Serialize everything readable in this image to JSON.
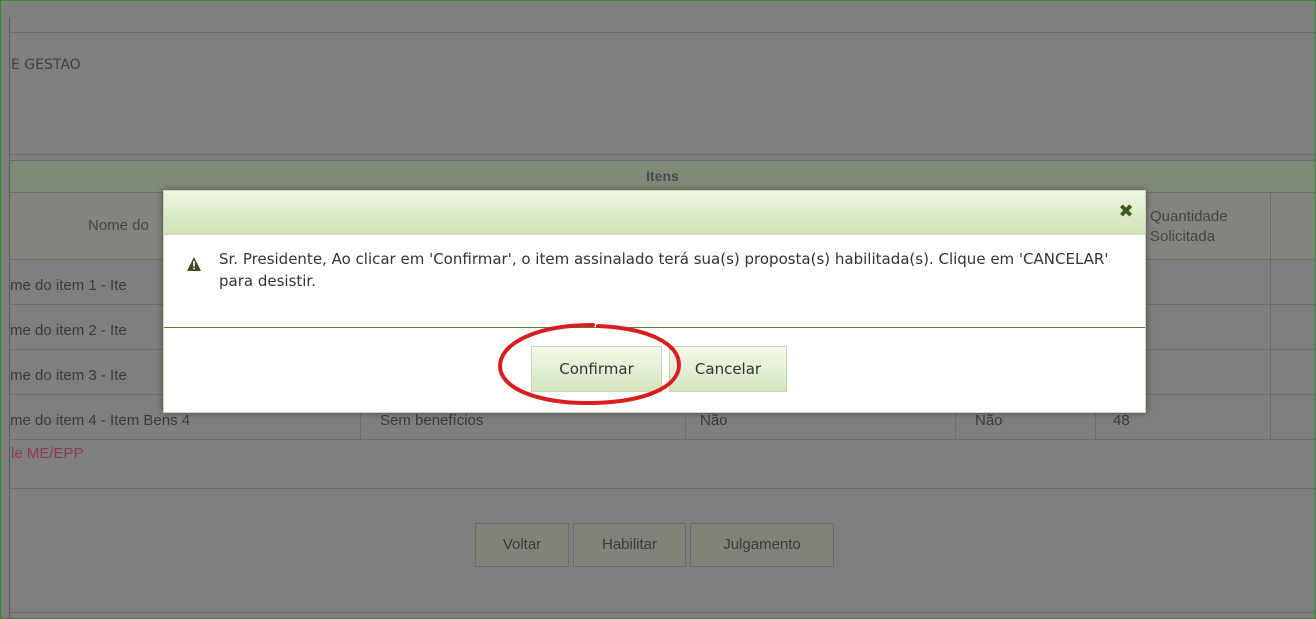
{
  "background": {
    "header_text": "E GESTAO",
    "section_title": "Itens",
    "columns": {
      "nome": "Nome do",
      "quantidade_line1": "Quantidade",
      "quantidade_line2": "Solicitada"
    },
    "rows": [
      {
        "name": "me do item 1 - Ite"
      },
      {
        "name": "me do item 2 - Ite"
      },
      {
        "name": "me do item 3 - Ite"
      },
      {
        "name": "me do item 4 - Item Bens 4",
        "beneficio": "Sem benefícios",
        "col3": "Não",
        "col4": "Não",
        "quantidade": "48"
      }
    ],
    "me_epp_label": "le ME/EPP",
    "buttons": {
      "voltar": "Voltar",
      "habilitar": "Habilitar",
      "julgamento": "Julgamento"
    }
  },
  "modal": {
    "close_icon": "✖",
    "warning_icon": "warning-triangle",
    "message": "Sr. Presidente, Ao clicar em 'Confirmar', o item assinalado terá sua(s) proposta(s) habilitada(s). Clique em 'CANCELAR' para desistir.",
    "confirm_label": "Confirmar",
    "cancel_label": "Cancelar"
  },
  "colors": {
    "overlay": "#7f7f7f",
    "modal_header": "#d9e8c6",
    "highlight_circle": "#d81e1e",
    "frame_border": "#2e8b2e"
  }
}
